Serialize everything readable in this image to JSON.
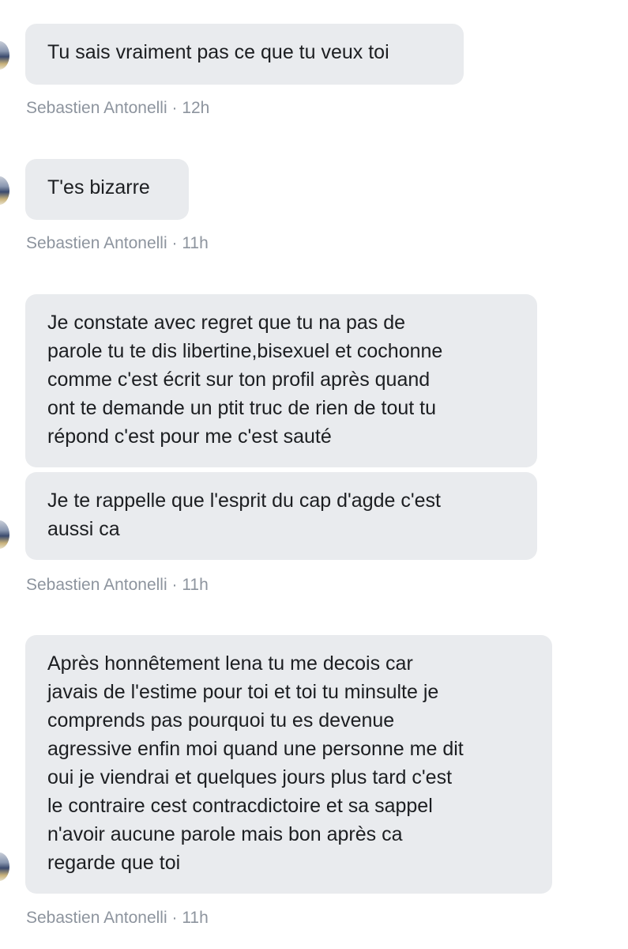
{
  "conversation": {
    "groups": [
      {
        "messages": [
          "Tu sais vraiment pas ce que tu veux toi"
        ],
        "sender": "Sebastien Antonelli",
        "time": "12h"
      },
      {
        "messages": [
          "T'es bizarre"
        ],
        "sender": "Sebastien Antonelli",
        "time": "11h"
      },
      {
        "messages": [
          "Je constate avec regret que tu na pas de\nparole tu te dis libertine,bisexuel et cochonne\ncomme c'est écrit sur ton profil après quand\nont te demande un ptit truc de rien de tout tu\nrépond c'est pour me c'est sauté",
          "Je te rappelle que l'esprit du cap d'agde c'est\naussi ca"
        ],
        "sender": "Sebastien Antonelli",
        "time": "11h"
      },
      {
        "messages": [
          "Après honnêtement lena tu me decois car\njavais de l'estime pour toi et toi tu minsulte je\ncomprends pas pourquoi tu es devenue\nagressive enfin moi quand une personne me dit\noui je viendrai et quelques jours plus tard c'est\nle contraire cest contracdictoire et sa sappel\nn'avoir aucune parole mais bon après ca\nregarde que toi"
        ],
        "sender": "Sebastien Antonelli",
        "time": "11h"
      }
    ],
    "separator": " · "
  }
}
